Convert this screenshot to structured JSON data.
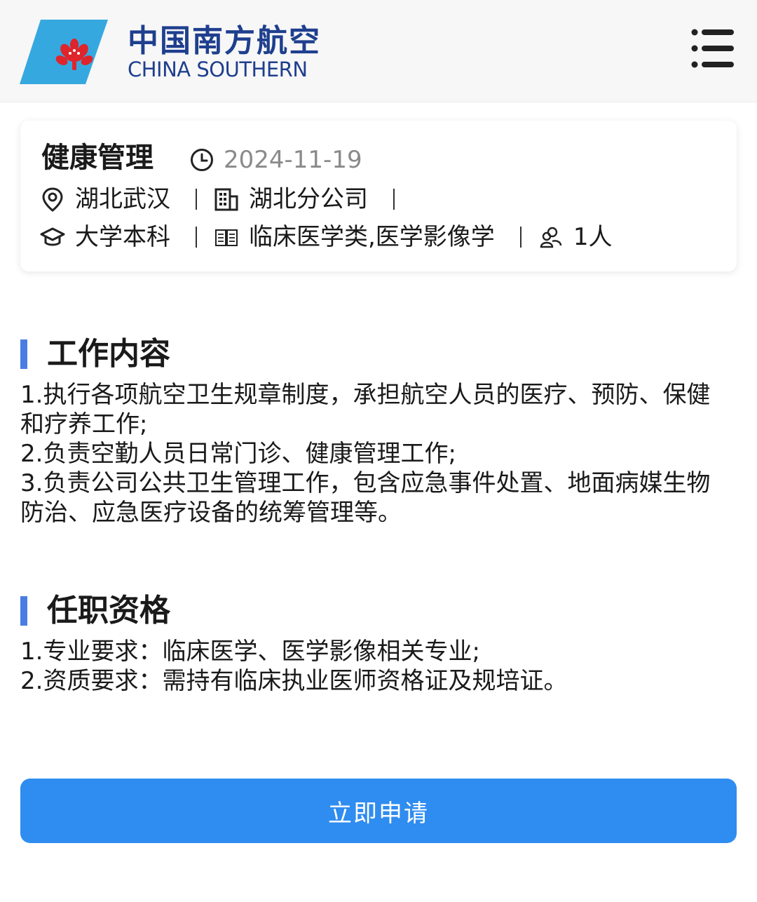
{
  "header": {
    "brand_cn": "中国南方航空",
    "brand_en": "CHINA SOUTHERN",
    "logo_icon": "kapok-flower-logo-icon",
    "menu_icon": "hamburger-menu-icon",
    "brand_color": "#1f3f8e",
    "logo_color": "#36a8e0",
    "flower_color": "#e0242b"
  },
  "job": {
    "title": "健康管理",
    "date": "2024-11-19",
    "location": "湖北武汉",
    "company": "湖北分公司",
    "education": "大学本科",
    "major": "临床医学类,医学影像学",
    "headcount": "1人"
  },
  "sections": {
    "duties": {
      "title": "工作内容",
      "lines": [
        "1.执行各项航空卫生规章制度，承担航空人员的医疗、预防、保健和疗养工作;",
        "2.负责空勤人员日常门诊、健康管理工作;",
        "3.负责公司公共卫生管理工作，包含应急事件处置、地面病媒生物防治、应急医疗设备的统筹管理等。"
      ]
    },
    "requirements": {
      "title": "任职资格",
      "lines": [
        "1.专业要求：临床医学、医学影像相关专业;",
        "2.资质要求：需持有临床执业医师资格证及规培证。"
      ]
    }
  },
  "apply": {
    "label": "立即申请",
    "color": "#2f8cf0"
  },
  "accent_color": "#4a7de2"
}
